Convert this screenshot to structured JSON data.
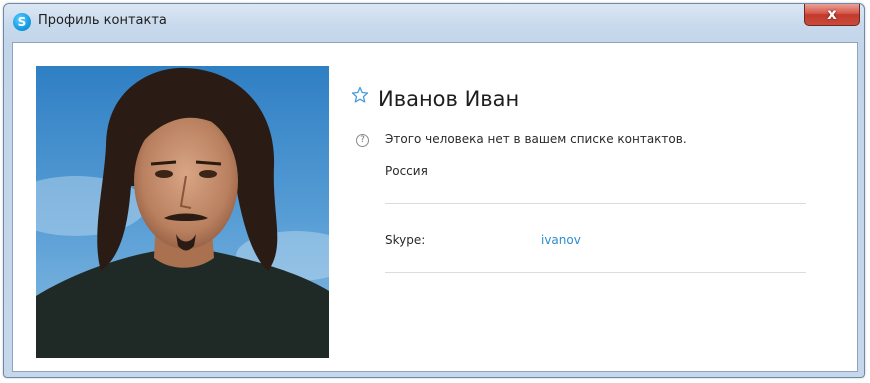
{
  "window": {
    "title": "Профиль контакта",
    "app_icon": "skype-icon",
    "close_label": "x"
  },
  "profile": {
    "photo": "contact-photo",
    "star_icon": "star-outline-icon",
    "name": "Иванов Иван",
    "help_icon": "question-circle-icon",
    "help_symbol": "?",
    "notice": "Этого человека нет в вашем списке контактов.",
    "country": "Россия",
    "skype_label": "Skype:",
    "skype_value": "ivanov"
  },
  "colors": {
    "link": "#2a8ecf",
    "star": "#4a9ad8",
    "close_button": "#c94a3c"
  }
}
